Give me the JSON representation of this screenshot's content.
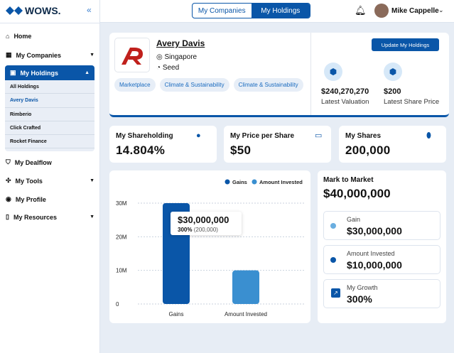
{
  "brand": "WOWS.",
  "sidebar": {
    "items": [
      {
        "label": "Home",
        "icon": "home-icon"
      },
      {
        "label": "My Companies",
        "icon": "building-icon"
      },
      {
        "label": "My Holdings",
        "icon": "boxes-icon"
      },
      {
        "label": "My Dealflow",
        "icon": "shield-icon"
      },
      {
        "label": "My Tools",
        "icon": "tools-icon"
      },
      {
        "label": "My Profile",
        "icon": "user-icon"
      },
      {
        "label": "My Resources",
        "icon": "book-icon"
      }
    ],
    "holdings": [
      "All Holdings",
      "Avery Davis",
      "Rimberio",
      "Click Crafted",
      "Rocket Finance"
    ],
    "active_holding": "Avery Davis"
  },
  "topbar": {
    "tabs": [
      "My Companies",
      "My Holdings"
    ],
    "active_tab": "My Holdings",
    "user": "Mike Cappelle"
  },
  "company": {
    "name": "Avery Davis",
    "location": "Singapore",
    "stage": "Seed",
    "tags": [
      "Marketplace",
      "Climate & Sustainability",
      "Climate & Sustainability"
    ],
    "update_button": "Update My Holdings",
    "valuation": "$240,270,270",
    "valuation_label": "Latest Valuation",
    "share_price": "$200",
    "share_price_label": "Latest Share Price"
  },
  "stats": [
    {
      "label": "My Shareholding",
      "value": "14.804%"
    },
    {
      "label": "My Price per Share",
      "value": "$50"
    },
    {
      "label": "My Shares",
      "value": "200,000"
    }
  ],
  "chart_data": {
    "type": "bar",
    "categories": [
      "Gains",
      "Amount Invested"
    ],
    "values": [
      30000000,
      10000000
    ],
    "colors": [
      "#0a56a8",
      "#3a8fd0"
    ],
    "legend": [
      "Gains",
      "Amount Invested"
    ],
    "legend_position": "top-right",
    "yticks": [
      "0",
      "10M",
      "20M",
      "30M"
    ],
    "ylim": [
      0,
      30000000
    ],
    "grid": true,
    "tooltip": {
      "value": "$30,000,000",
      "pct": "300%",
      "shares": "(200,000)"
    }
  },
  "mtm": {
    "title": "Mark to Market",
    "value": "$40,000,000",
    "items": [
      {
        "label": "Gain",
        "value": "$30,000,000",
        "color": "#6aaee0"
      },
      {
        "label": "Amount Invested",
        "value": "$10,000,000",
        "color": "#0a56a8"
      },
      {
        "label": "My Growth",
        "value": "300%"
      }
    ]
  }
}
